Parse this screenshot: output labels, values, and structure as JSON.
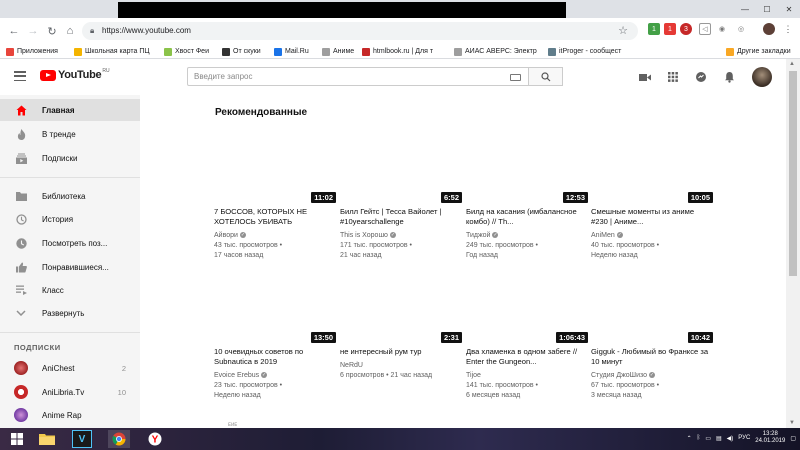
{
  "browser": {
    "url": "https://www.youtube.com",
    "bookmarks": [
      {
        "label": "Приложения",
        "color": "#e8453c"
      },
      {
        "label": "Школьная карта ПЦ",
        "color": "#f4b400"
      },
      {
        "label": "Хвост Феи",
        "color": "#8bc34a"
      },
      {
        "label": "От скуки",
        "color": "#333333"
      },
      {
        "label": "Mail.Ru",
        "color": "#1a73e8"
      },
      {
        "label": "Аниме",
        "color": "#9e9e9e"
      },
      {
        "label": "htmlbook.ru | Для т",
        "color": "#c62828"
      },
      {
        "label": "АИАС АВЕРС: Электр",
        "color": "#9e9e9e"
      },
      {
        "label": "itProger - сообщест",
        "color": "#607d8b"
      }
    ],
    "other_bookmarks": "Другие закладки",
    "ext_badges": [
      "1",
      "1",
      "3"
    ]
  },
  "youtube": {
    "logo_text": "YouTube",
    "logo_region": "RU",
    "search_placeholder": "Введите запрос",
    "sidebar": {
      "items": [
        {
          "label": "Главная",
          "icon": "home-icon",
          "active": true
        },
        {
          "label": "В тренде",
          "icon": "trending-icon",
          "active": false
        },
        {
          "label": "Подписки",
          "icon": "subscriptions-icon",
          "active": false
        },
        {
          "label": "Библиотека",
          "icon": "library-icon",
          "active": false
        },
        {
          "label": "История",
          "icon": "history-icon",
          "active": false
        },
        {
          "label": "Посмотреть поз...",
          "icon": "watch-later-icon",
          "active": false
        },
        {
          "label": "Понравившиеся...",
          "icon": "liked-icon",
          "active": false
        },
        {
          "label": "Класс",
          "icon": "playlist-icon",
          "active": false
        },
        {
          "label": "Развернуть",
          "icon": "chevron-down-icon",
          "active": false
        }
      ],
      "subscriptions_title": "ПОДПИСКИ",
      "subscriptions": [
        {
          "name": "AniChest",
          "count": "2",
          "color": "#b71c1c"
        },
        {
          "name": "AniLibria.Tv",
          "count": "10",
          "color": "#c62828"
        },
        {
          "name": "Anime Rap",
          "count": "",
          "color": "#4a148c"
        }
      ]
    },
    "section_title": "Рекомендованные",
    "videos": [
      {
        "title": "7 БОССОВ, КОТОРЫХ НЕ ХОТЕЛОСЬ УБИВАТЬ",
        "channel": "Айвори",
        "verified": true,
        "views": "43 тыс. просмотров",
        "age": "17 часов назад",
        "duration": "11:02"
      },
      {
        "title": "Билл Гейтс | Тесса Вайолет | #10yearschallenge",
        "channel": "This is Хорошо",
        "verified": true,
        "views": "171 тыс. просмотров",
        "age": "21 час назад",
        "duration": "6:52"
      },
      {
        "title": "Билд на касания (имбалансное комбо) // Th...",
        "channel": "Тиджой",
        "verified": true,
        "views": "249 тыс. просмотров",
        "age": "Год назад",
        "duration": "12:53"
      },
      {
        "title": "Смешные моменты из аниме #230 | Аниме...",
        "channel": "AniMen",
        "verified": true,
        "views": "40 тыс. просмотров",
        "age": "Неделю назад",
        "duration": "10:05"
      },
      {
        "title": "10 очевидных советов по Subnautica в 2019",
        "channel": "Evoice Erebus",
        "verified": true,
        "views": "23 тыс. просмотров",
        "age": "Неделю назад",
        "duration": "13:50"
      },
      {
        "title": "не интересный рум тур",
        "channel": "NeRdU",
        "verified": false,
        "views": "6 просмотров",
        "age": "21 час назад",
        "duration": "2:31"
      },
      {
        "title": "Два хламенка в одном забеге // Enter the Gungeon...",
        "channel": "Tijoe",
        "verified": false,
        "views": "141 тыс. просмотров",
        "age": "6 месяцев назад",
        "duration": "1:06:43"
      },
      {
        "title": "Gigguk - Любимый во Франксе за 10 минут",
        "channel": "Студия ДжоШизо",
        "verified": true,
        "views": "67 тыс. просмотров",
        "age": "3 месяца назад",
        "duration": "10:42"
      }
    ],
    "partial_text": "ᴇᴎᴇ"
  },
  "taskbar": {
    "language": "РУС",
    "time": "13:28",
    "date": "24.01.2019"
  }
}
